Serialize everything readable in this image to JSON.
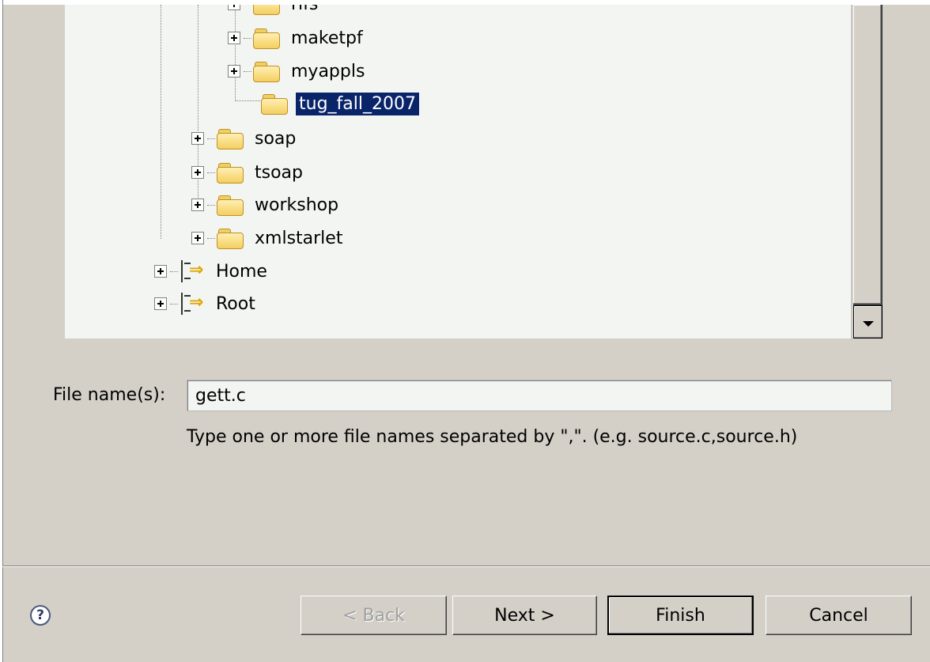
{
  "tree": {
    "items": [
      {
        "label": "rifs",
        "expandable": true
      },
      {
        "label": "maketpf",
        "expandable": true
      },
      {
        "label": "myappls",
        "expandable": true
      },
      {
        "label": "tug_fall_2007",
        "expandable": false,
        "selected": true
      },
      {
        "label": "soap",
        "expandable": true
      },
      {
        "label": "tsoap",
        "expandable": true
      },
      {
        "label": "workshop",
        "expandable": true
      },
      {
        "label": "xmlstarlet",
        "expandable": true
      },
      {
        "label": "Home",
        "expandable": true,
        "icon": "shortcut-icon"
      },
      {
        "label": "Root",
        "expandable": true,
        "icon": "shortcut-icon"
      }
    ]
  },
  "file_name": {
    "label": "File name(s):",
    "value": "gett.c",
    "hint": "Type one or more file names separated by \",\".  (e.g. source.c,source.h)"
  },
  "buttons": {
    "back": "< Back",
    "next": "Next >",
    "finish": "Finish",
    "cancel": "Cancel"
  },
  "help": {
    "icon": "help-icon",
    "glyph": "?"
  },
  "colors": {
    "dialog_bg": "#d4d0c8",
    "tree_bg": "#f2f5f2",
    "selection_bg": "#0a246a",
    "folder": "#f4cf60"
  }
}
